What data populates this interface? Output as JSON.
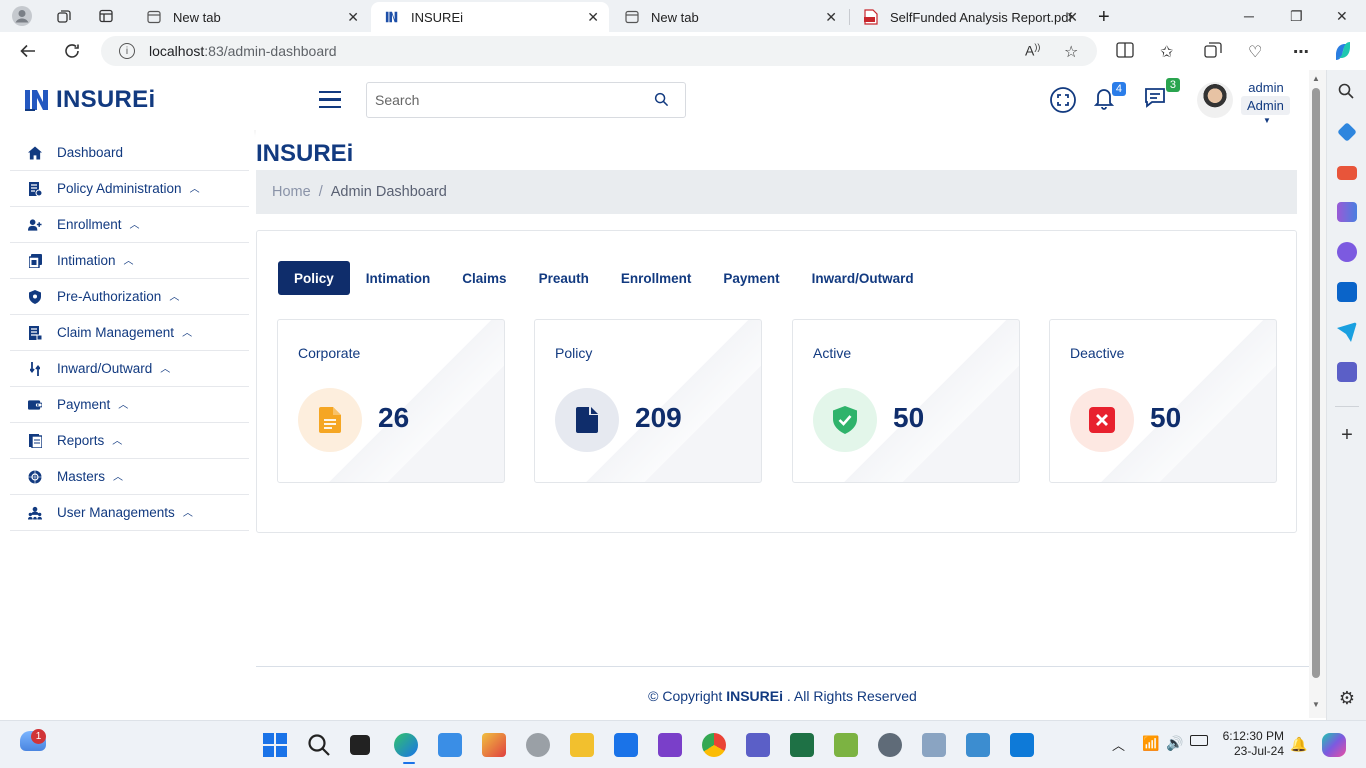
{
  "browser": {
    "tabs": [
      {
        "title": "New tab"
      },
      {
        "title": "INSUREi"
      },
      {
        "title": "New tab"
      },
      {
        "title": "SelfFunded Analysis Report.pdf"
      }
    ],
    "url_host": "localhost",
    "url_path": ":83/admin-dashboard"
  },
  "header": {
    "brand": "INSUREi",
    "search_placeholder": "Search",
    "notifications_count": "4",
    "messages_count": "3",
    "user_name": "admin",
    "user_role": "Admin"
  },
  "sidebar": {
    "items": [
      {
        "label": "Dashboard",
        "icon": "home-icon",
        "expandable": false
      },
      {
        "label": "Policy Administration",
        "icon": "policy-icon",
        "expandable": true
      },
      {
        "label": "Enrollment",
        "icon": "user-plus-icon",
        "expandable": true
      },
      {
        "label": "Intimation",
        "icon": "intimation-icon",
        "expandable": true
      },
      {
        "label": "Pre-Authorization",
        "icon": "shield-icon",
        "expandable": true
      },
      {
        "label": "Claim Management",
        "icon": "claim-icon",
        "expandable": true
      },
      {
        "label": "Inward/Outward",
        "icon": "transfer-icon",
        "expandable": true
      },
      {
        "label": "Payment",
        "icon": "payment-icon",
        "expandable": true
      },
      {
        "label": "Reports",
        "icon": "report-icon",
        "expandable": true
      },
      {
        "label": "Masters",
        "icon": "masters-icon",
        "expandable": true
      },
      {
        "label": "User Managements",
        "icon": "users-icon",
        "expandable": true
      }
    ]
  },
  "main": {
    "title": "INSUREi",
    "breadcrumb_home": "Home",
    "breadcrumb_sep": "/",
    "breadcrumb_current": "Admin Dashboard",
    "tabs": [
      "Policy",
      "Intimation",
      "Claims",
      "Preauth",
      "Enrollment",
      "Payment",
      "Inward/Outward"
    ],
    "active_tab": "Policy",
    "stats": [
      {
        "label": "Corporate",
        "value": "26",
        "icon": "document-icon",
        "color": "#f5a623",
        "bg": "#fdeedd"
      },
      {
        "label": "Policy",
        "value": "209",
        "icon": "file-icon",
        "color": "#0f2d6b",
        "bg": "#e6e9f0"
      },
      {
        "label": "Active",
        "value": "50",
        "icon": "shield-check-icon",
        "color": "#2fb36b",
        "bg": "#e3f6ea"
      },
      {
        "label": "Deactive",
        "value": "50",
        "icon": "close-box-icon",
        "color": "#e8212e",
        "bg": "#fde8e2"
      }
    ]
  },
  "footer": {
    "prefix": "© Copyright ",
    "brand": "INSUREi",
    "suffix": " . All Rights Reserved"
  },
  "taskbar": {
    "weather_badge": "1",
    "time": "6:12:30 PM",
    "date": "23-Jul-24"
  },
  "colors": {
    "brand": "#123a80",
    "active_tab": "#0f2d6b"
  }
}
